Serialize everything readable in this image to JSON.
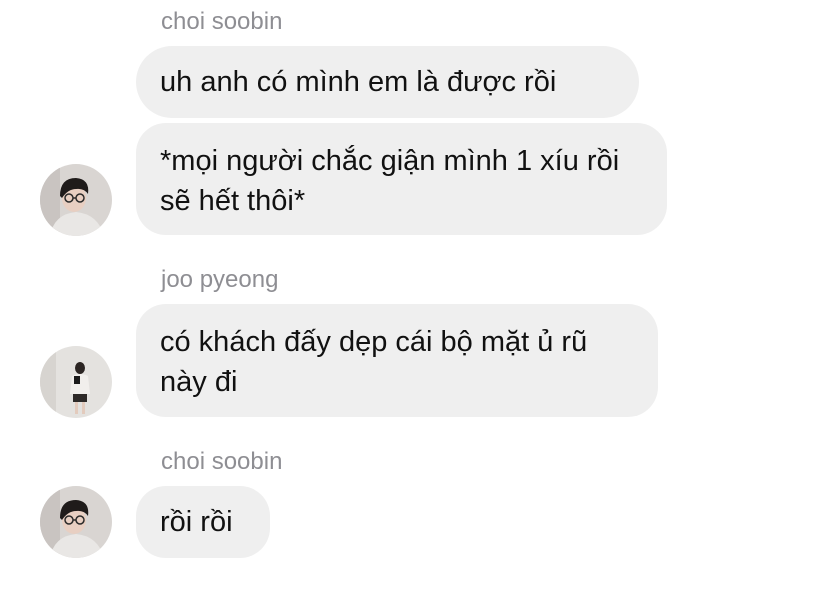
{
  "groups": [
    {
      "sender": "choi soobin",
      "avatar_icon": "boy-with-glasses-avatar-icon",
      "messages": [
        "uh anh có mình em là được rồi",
        "*mọi người chắc giận mình 1 xíu rồi sẽ hết thôi*"
      ]
    },
    {
      "sender": "joo pyeong",
      "avatar_icon": "girl-mirror-selfie-avatar-icon",
      "messages": [
        "có khách đấy dẹp cái bộ mặt ủ rũ này đi"
      ]
    },
    {
      "sender": "choi soobin",
      "avatar_icon": "boy-with-glasses-avatar-icon",
      "messages": [
        "rồi rồi"
      ]
    }
  ],
  "colors": {
    "bubble": "#efefef",
    "sender_name": "#8e8e93",
    "message_text": "#111111",
    "background": "#ffffff"
  }
}
